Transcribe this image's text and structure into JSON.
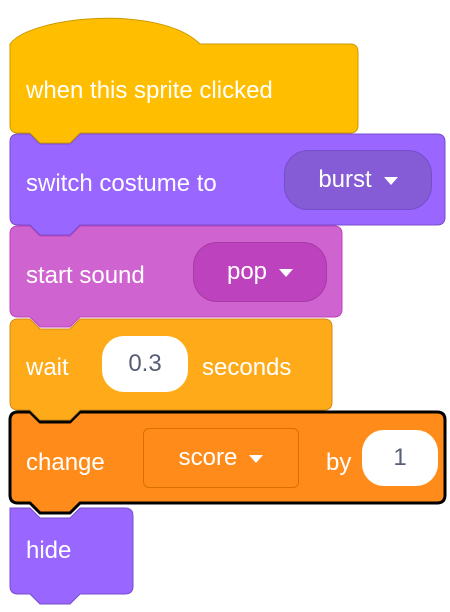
{
  "blocks": {
    "hat": {
      "label": "when this sprite clicked"
    },
    "switch_costume": {
      "label": "switch costume to",
      "value": "burst"
    },
    "start_sound": {
      "label": "start sound",
      "value": "pop"
    },
    "wait": {
      "label": "wait",
      "value": "0.3",
      "suffix": "seconds"
    },
    "change_var": {
      "label": "change",
      "variable": "score",
      "by_label": "by",
      "value": "1"
    },
    "hide": {
      "label": "hide"
    }
  },
  "colors": {
    "events": "#FFBF00",
    "looks": "#9966FF",
    "sound": "#CF63CF",
    "control": "#FFAB19",
    "variables": "#FF8C1A",
    "selected_outline": "#000000"
  }
}
